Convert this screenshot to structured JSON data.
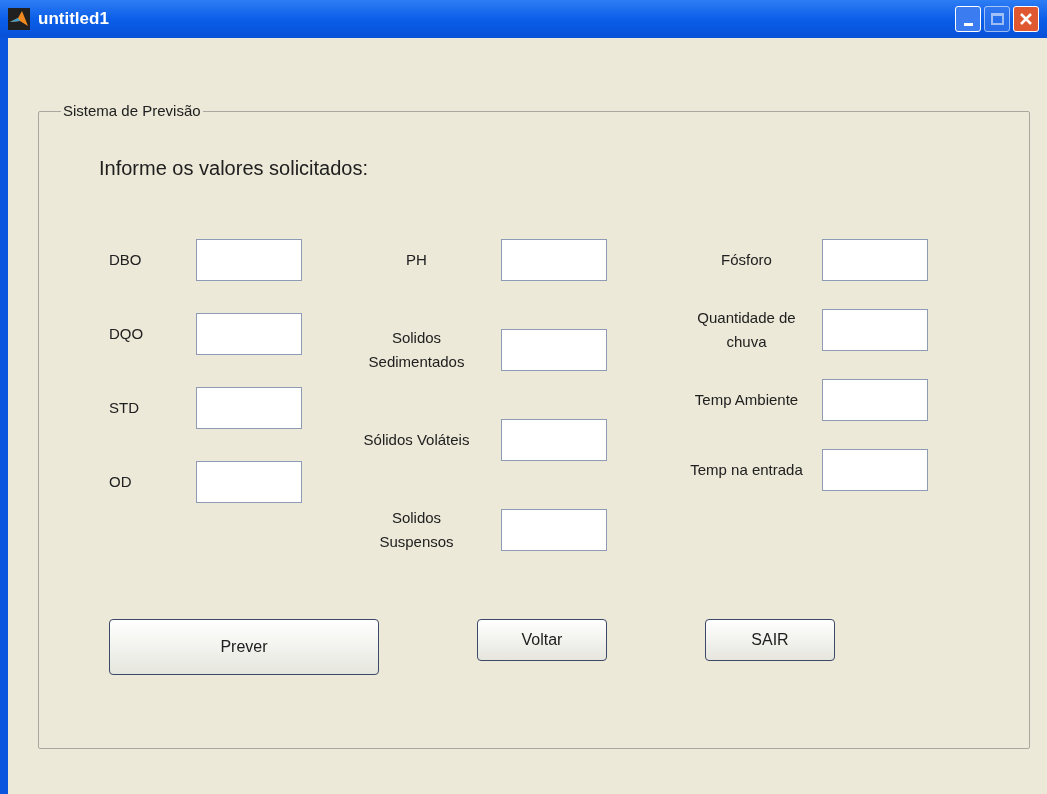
{
  "window": {
    "title": "untitled1"
  },
  "panel": {
    "title": "Sistema de Previsão",
    "prompt": "Informe os valores solicitados:",
    "columns": [
      [
        {
          "label": "DBO"
        },
        {
          "label": "DQO"
        },
        {
          "label": "STD"
        },
        {
          "label": "OD"
        }
      ],
      [
        {
          "label": "PH"
        },
        {
          "label": "Solidos Sedimentados"
        },
        {
          "label": "Sólidos Voláteis"
        },
        {
          "label": "Solidos Suspensos"
        }
      ],
      [
        {
          "label": "Fósforo"
        },
        {
          "label": "Quantidade de chuva"
        },
        {
          "label": "Temp Ambiente"
        },
        {
          "label": "Temp na entrada"
        }
      ]
    ],
    "buttons": [
      {
        "label": "Prever",
        "kind": "large"
      },
      {
        "label": "Voltar",
        "kind": "small"
      },
      {
        "label": "SAIR",
        "kind": "small"
      }
    ]
  }
}
